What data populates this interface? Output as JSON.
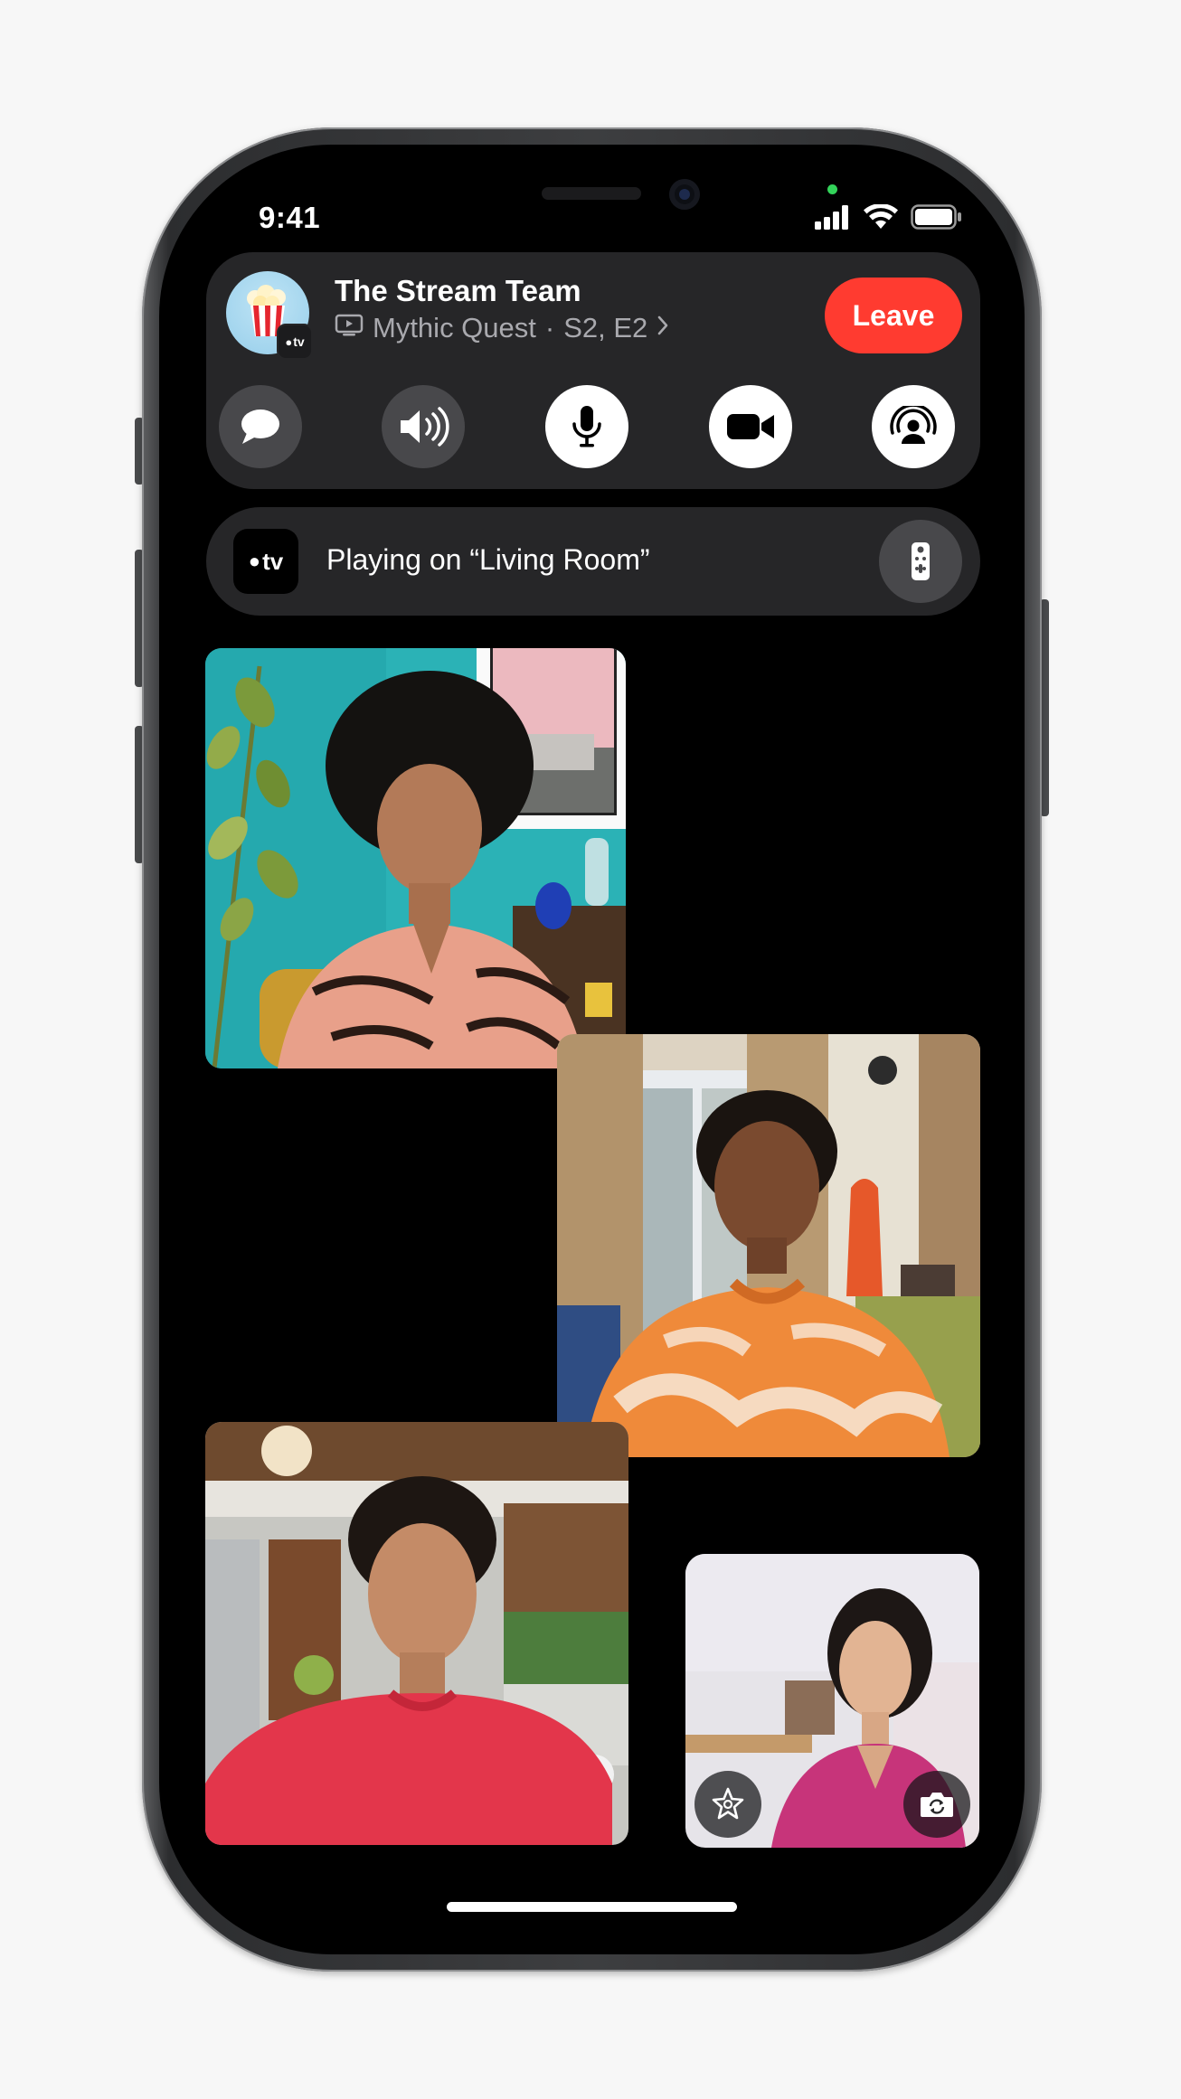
{
  "status_bar": {
    "time": "9:41",
    "icons": [
      "cellular-signal-icon",
      "wifi-icon",
      "battery-icon"
    ]
  },
  "shareplay": {
    "group_name": "The Stream Team",
    "group_avatar_icon": "popcorn-icon",
    "badge_text": "tv",
    "media_title": "Mythic Quest",
    "media_episode": "S2, E2",
    "media_separator": "·",
    "leave_label": "Leave",
    "leave_color": "#ff3b30",
    "controls": [
      {
        "name": "messages-button",
        "icon": "message-bubble-icon",
        "state": "off"
      },
      {
        "name": "speaker-button",
        "icon": "speaker-wave-icon",
        "state": "off"
      },
      {
        "name": "microphone-button",
        "icon": "microphone-icon",
        "state": "on"
      },
      {
        "name": "camera-button",
        "icon": "video-camera-icon",
        "state": "on"
      },
      {
        "name": "shareplay-button",
        "icon": "shareplay-icon",
        "state": "on"
      }
    ]
  },
  "now_playing": {
    "app_label": "tv",
    "text": "Playing on “Living Room”",
    "remote_icon": "remote-icon"
  },
  "participants": [
    {
      "name": "participant-1",
      "shirt_color": "#e8a08a"
    },
    {
      "name": "participant-2",
      "shirt_color": "#ef8a3a"
    },
    {
      "name": "participant-3",
      "shirt_color": "#e3364b"
    }
  ],
  "self_view": {
    "effects_icon": "star-effects-icon",
    "flip_icon": "camera-flip-icon"
  }
}
